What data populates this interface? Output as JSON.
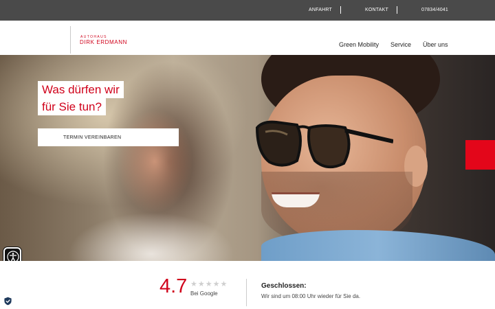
{
  "topbar": {
    "links": [
      "ANFAHRT",
      "KONTAKT",
      "07834/4041"
    ]
  },
  "logo": {
    "top_line": "AUTOHAUS",
    "main_line": "DIRK ERDMANN"
  },
  "nav": {
    "items": [
      "Green Mobility",
      "Service",
      "Über uns"
    ]
  },
  "hero": {
    "headline_line1": "Was dürfen wir",
    "headline_line2": "für Sie tun?",
    "cta_label": "TERMIN VEREINBAREN"
  },
  "rating": {
    "score": "4.7",
    "stars_filled": 0,
    "stars_total": 5,
    "source": "Bei Google"
  },
  "hours": {
    "status": "Geschlossen:",
    "note": "Wir sind um 08:00 Uhr wieder für Sie da."
  },
  "colors": {
    "brand_red": "#d0021b",
    "topbar_bg": "#4a4a4a"
  },
  "icons": [
    "accessibility-icon",
    "shield-check-icon",
    "star-icon"
  ]
}
